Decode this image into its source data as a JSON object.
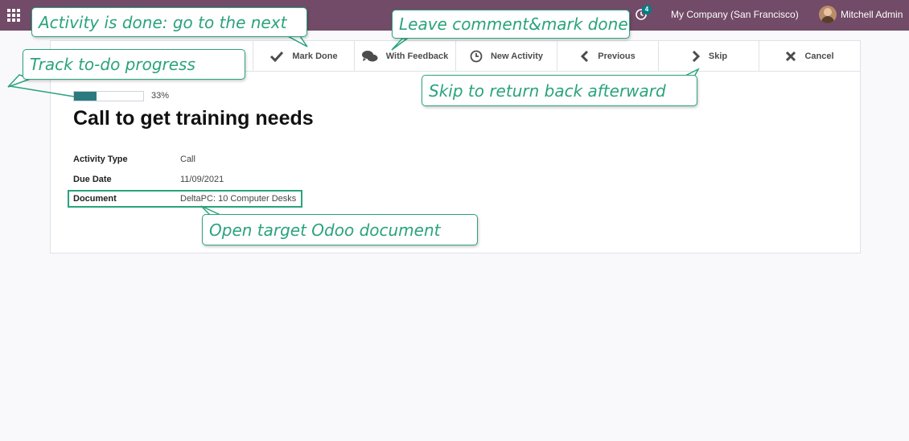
{
  "navbar": {
    "badge_count": "4",
    "company": "My Company (San Francisco)",
    "user_name": "Mitchell Admin",
    "icons": [
      "apps-grid-icon",
      "chat-icon",
      "clock-icon"
    ]
  },
  "toolbar": {
    "mark_done": "Mark Done",
    "with_feedback": "With Feedback",
    "new_activity": "New Activity",
    "previous": "Previous",
    "skip": "Skip",
    "cancel": "Cancel"
  },
  "progress": {
    "value": 0.33,
    "label": "33%"
  },
  "activity": {
    "title": "Call to get training needs",
    "fields": {
      "activity_type_label": "Activity Type",
      "activity_type_value": "Call",
      "due_date_label": "Due Date",
      "due_date_value": "11/09/2021",
      "document_label": "Document",
      "document_value": "DeltaPC: 10 Computer Desks"
    }
  },
  "callouts": {
    "done_next": "Activity is done: go to the next",
    "comment_done": "Leave comment&mark done",
    "track_progress": "Track to-do progress",
    "skip_back": "Skip to return back afterward",
    "open_document": "Open target Odoo document"
  },
  "colors": {
    "navbar": "#714b67",
    "accent": "#2aa37d",
    "progress": "#2b7a80",
    "badge": "#017e84"
  }
}
